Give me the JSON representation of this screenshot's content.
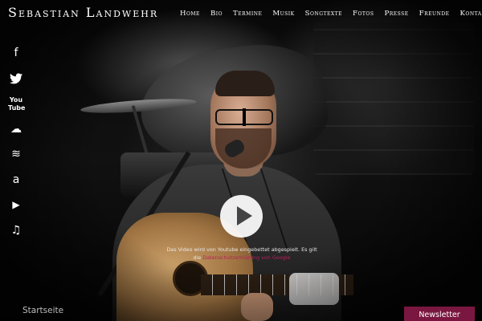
{
  "header": {
    "site_title": "Sebastian Landwehr",
    "nav": {
      "home": "Home",
      "bio": "Bio",
      "termine": "Termine",
      "musik": "Musik",
      "songtexte": "Songtexte",
      "fotos": "Fotos",
      "presse": "Presse",
      "freunde": "Freunde",
      "kontakt": "Kontakt"
    }
  },
  "social": {
    "facebook": {
      "icon": "facebook-icon",
      "glyph": "f"
    },
    "twitter": {
      "icon": "twitter-icon",
      "glyph": "🐦"
    },
    "youtube": {
      "icon": "youtube-icon",
      "glyph": "You\nTube"
    },
    "soundcloud": {
      "icon": "soundcloud-icon",
      "glyph": "☁"
    },
    "spotify": {
      "icon": "spotify-icon",
      "glyph": "≋"
    },
    "amazon": {
      "icon": "amazon-icon",
      "glyph": "a"
    },
    "google_play": {
      "icon": "google-play-icon",
      "glyph": "▶"
    },
    "itunes": {
      "icon": "itunes-icon",
      "glyph": "♫"
    }
  },
  "video": {
    "notice_line1": "Das Video wird von Youtube eingebettet abgespielt. Es gilt",
    "notice_line2_prefix": "die ",
    "privacy_link": "Datenschutzerklärung von Google"
  },
  "footer": {
    "home_link": "Startseite",
    "newsletter_button": "Newsletter"
  },
  "colors": {
    "accent": "#7a1740",
    "link": "#b8205a",
    "background": "#000000"
  }
}
